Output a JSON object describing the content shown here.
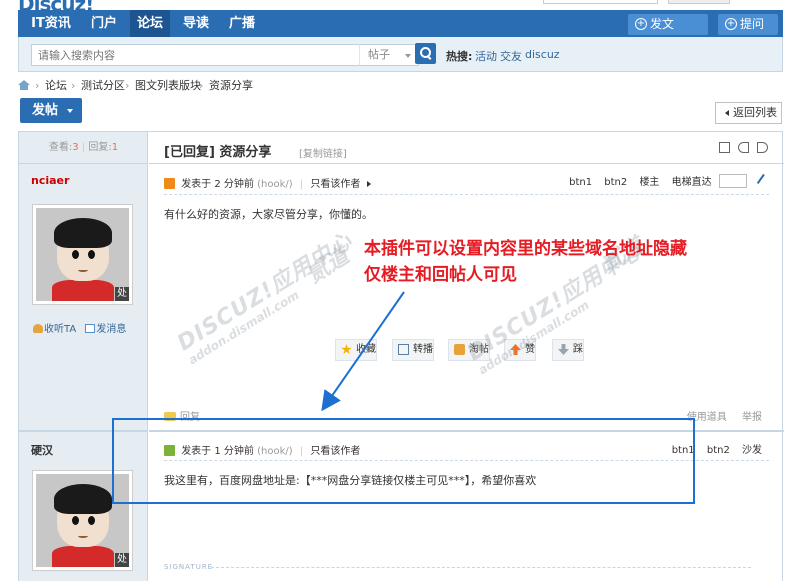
{
  "nav": {
    "items": [
      "IT资讯",
      "门户",
      "论坛",
      "导读",
      "广播"
    ],
    "active_index": 2,
    "post_article": "发文",
    "ask_question": "提问",
    "pill_icon": "plus-circle-icon"
  },
  "search": {
    "placeholder": "请输入搜索内容",
    "type_label": "帖子",
    "hot_label": "热搜:",
    "hot_links": [
      "活动",
      "交友",
      "discuz"
    ]
  },
  "breadcrumb": [
    "论坛",
    "测试分区",
    "图文列表版块",
    "资源分享"
  ],
  "buttons": {
    "new_post": "发帖",
    "return_list": "返回列表"
  },
  "thread": {
    "views_label": "查看:",
    "views": "3",
    "replies_label": "回复:",
    "replies": "1",
    "status": "[已回复]",
    "title": "资源分享",
    "copy_link": "[复制链接]"
  },
  "post1": {
    "author": "nciaer",
    "posted": "发表于 2 分钟前",
    "client": "(hook/)",
    "only_author": "只看该作者",
    "floor_links": [
      "btn1",
      "btn2",
      "楼主",
      "电梯直达"
    ],
    "body": "有什么好的资源，大家尽管分享，你懂的。",
    "listen": "收听TA",
    "message": "发消息",
    "badge": "处",
    "actions": [
      "收藏",
      "转播",
      "淘帖",
      "赞",
      "踩"
    ],
    "reply_link": "回复",
    "tools": "使用道具",
    "report": "举报"
  },
  "post2": {
    "author": "硬汉",
    "posted": "发表于 1 分钟前",
    "client": "(hook/)",
    "only_author": "只看该作者",
    "floor_links": [
      "btn1",
      "btn2",
      "沙发"
    ],
    "body": "我这里有，百度网盘地址是:【***网盘分享链接仅楼主可见***】，希望你喜欢",
    "badge": "处",
    "signature": "SIGNATURE"
  },
  "annotation": {
    "line1": "本插件可以设置内容里的某些域名地址隐藏",
    "line2": "仅楼主和回帖人可见"
  },
  "watermark": {
    "brand": "DISCUZ!应用中心",
    "domain": "addon.dismall.com",
    "extra": "贰道"
  },
  "colors": {
    "nav_blue": "#2b6db3",
    "annotation_red": "#e51c23",
    "highlight_blue": "#1d6fd0",
    "author_red": "#cc0000"
  }
}
